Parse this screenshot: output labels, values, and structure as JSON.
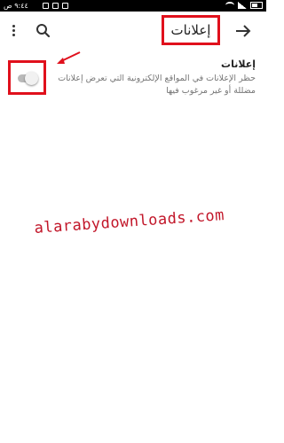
{
  "status_bar": {
    "time": "٩:٤٤ ص"
  },
  "toolbar": {
    "title": "إعلانات",
    "back_icon": "arrow-right-icon",
    "search_icon": "search-icon",
    "menu_icon": "more-vert-icon"
  },
  "setting": {
    "title": "إعلانات",
    "description": "حظر الإعلانات في المواقع الإلكترونية التي تعرض إعلانات مضللة أو غير مرغوب فيها",
    "toggle_on": false
  },
  "watermark": "alarabydownloads.com",
  "colors": {
    "highlight": "#e0101c",
    "watermark": "#c2172a",
    "toggle_track": "#b9b9b9",
    "toggle_thumb": "#f1f1f1"
  }
}
